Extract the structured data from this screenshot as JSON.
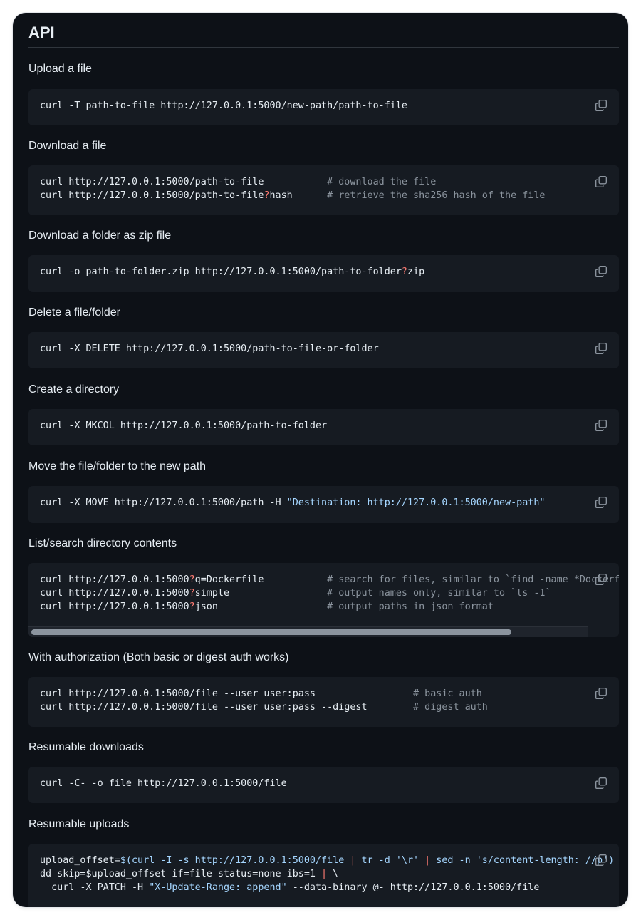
{
  "title": "API",
  "copy_icon": "copy-icon",
  "colors": {
    "background": "#0d1117",
    "code_bg": "#161b22",
    "text": "#e6edf3",
    "comment": "#8b949e",
    "string": "#a5d6ff",
    "operator": "#ff7b72"
  },
  "sections": [
    {
      "heading": "Upload a file",
      "lines": [
        [
          {
            "t": "curl -T path-to-file http://127.0.0.1:5000/new-path/path-to-file"
          }
        ]
      ]
    },
    {
      "heading": "Download a file",
      "lines": [
        [
          {
            "t": "curl http://127.0.0.1:5000/path-to-file           "
          },
          {
            "t": "# download the file",
            "k": "c"
          }
        ],
        [
          {
            "t": "curl http://127.0.0.1:5000/path-to-file"
          },
          {
            "t": "?",
            "k": "o"
          },
          {
            "t": "hash      "
          },
          {
            "t": "# retrieve the sha256 hash of the file",
            "k": "c"
          }
        ]
      ]
    },
    {
      "heading": "Download a folder as zip file",
      "lines": [
        [
          {
            "t": "curl -o path-to-folder.zip http://127.0.0.1:5000/path-to-folder"
          },
          {
            "t": "?",
            "k": "o"
          },
          {
            "t": "zip"
          }
        ]
      ]
    },
    {
      "heading": "Delete a file/folder",
      "lines": [
        [
          {
            "t": "curl -X DELETE http://127.0.0.1:5000/path-to-file-or-folder"
          }
        ]
      ]
    },
    {
      "heading": "Create a directory",
      "lines": [
        [
          {
            "t": "curl -X MKCOL http://127.0.0.1:5000/path-to-folder"
          }
        ]
      ]
    },
    {
      "heading": "Move the file/folder to the new path",
      "lines": [
        [
          {
            "t": "curl -X MOVE http://127.0.0.1:5000/path -H "
          },
          {
            "t": "\"Destination: http://127.0.0.1:5000/new-path\"",
            "k": "s"
          }
        ]
      ]
    },
    {
      "heading": "List/search directory contents",
      "scroll": true,
      "lines": [
        [
          {
            "t": "curl http://127.0.0.1:5000"
          },
          {
            "t": "?",
            "k": "o"
          },
          {
            "t": "q=Dockerfile           "
          },
          {
            "t": "# search for files, similar to `find -name *Dockerfile*`",
            "k": "c"
          }
        ],
        [
          {
            "t": "curl http://127.0.0.1:5000"
          },
          {
            "t": "?",
            "k": "o"
          },
          {
            "t": "simple                 "
          },
          {
            "t": "# output names only, similar to `ls -1`",
            "k": "c"
          }
        ],
        [
          {
            "t": "curl http://127.0.0.1:5000"
          },
          {
            "t": "?",
            "k": "o"
          },
          {
            "t": "json                   "
          },
          {
            "t": "# output paths in json format",
            "k": "c"
          }
        ]
      ]
    },
    {
      "heading": "With authorization (Both basic or digest auth works)",
      "lines": [
        [
          {
            "t": "curl http://127.0.0.1:5000/file --user user:pass                 "
          },
          {
            "t": "# basic auth",
            "k": "c"
          }
        ],
        [
          {
            "t": "curl http://127.0.0.1:5000/file --user user:pass --digest        "
          },
          {
            "t": "# digest auth",
            "k": "c"
          }
        ]
      ]
    },
    {
      "heading": "Resumable downloads",
      "lines": [
        [
          {
            "t": "curl -C- -o file http://127.0.0.1:5000/file"
          }
        ]
      ]
    },
    {
      "heading": "Resumable uploads",
      "lines": [
        [
          {
            "t": "upload_offset="
          },
          {
            "t": "$(curl -I -s http://127.0.0.1:5000/file ",
            "k": "s"
          },
          {
            "t": "|",
            "k": "o"
          },
          {
            "t": " tr -d '\\r' ",
            "k": "s"
          },
          {
            "t": "|",
            "k": "o"
          },
          {
            "t": " sed -n 's/content-length: //p')",
            "k": "s"
          }
        ],
        [
          {
            "t": "dd skip=$upload_offset if=file status=none ibs=1 "
          },
          {
            "t": "|",
            "k": "o"
          },
          {
            "t": " \\"
          }
        ],
        [
          {
            "t": "  curl -X PATCH -H "
          },
          {
            "t": "\"X-Update-Range: append\"",
            "k": "s"
          },
          {
            "t": " --data-binary @- http://127.0.0.1:5000/file"
          }
        ]
      ]
    }
  ]
}
